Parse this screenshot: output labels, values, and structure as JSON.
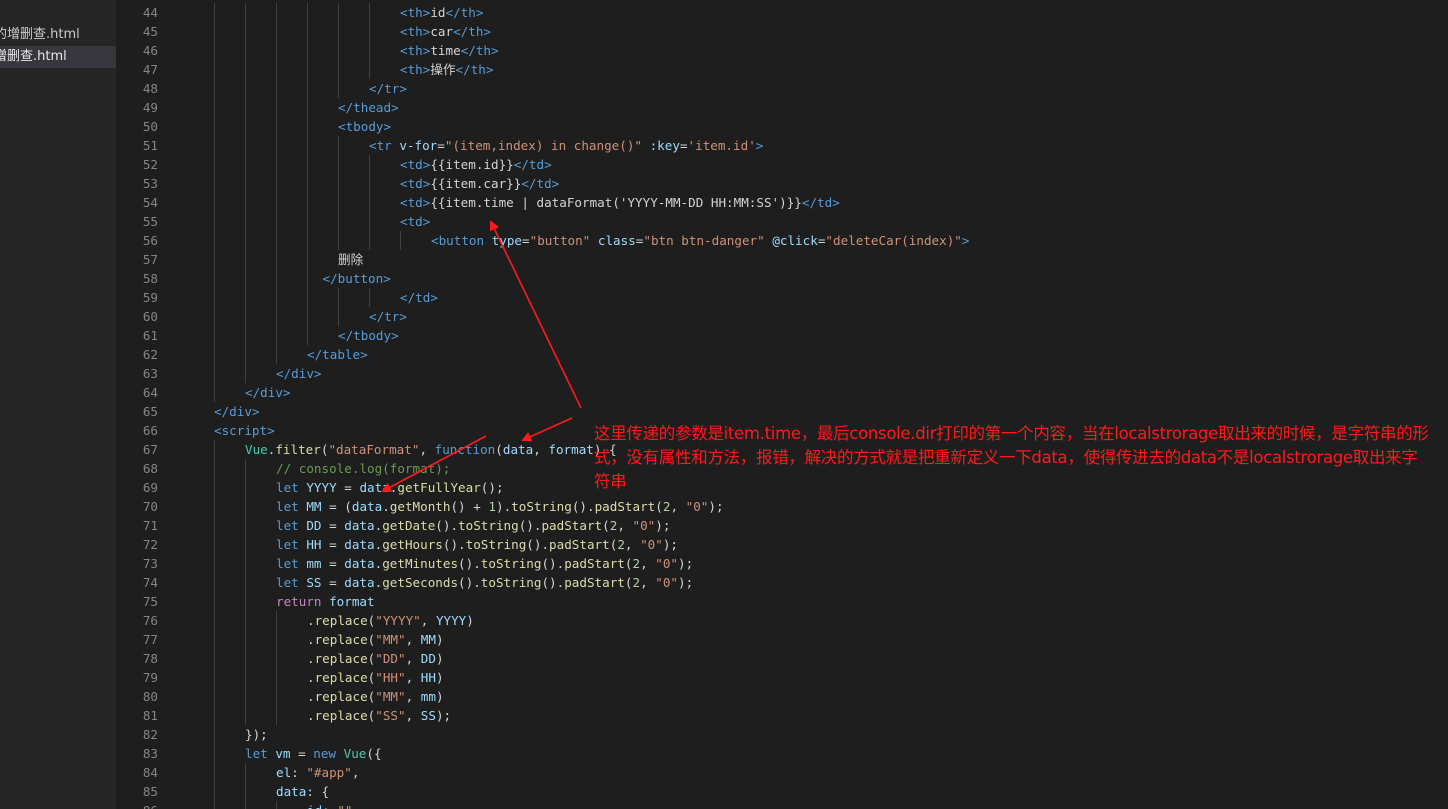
{
  "explorer": {
    "files": [
      {
        "label": "的增删查.html",
        "active": false
      },
      {
        "label": "增删查.html",
        "active": true
      }
    ]
  },
  "editor": {
    "lines": [
      {
        "n": "44",
        "indent": 6,
        "tokens": [
          [
            "tag",
            "<th>"
          ],
          [
            "text",
            "id"
          ],
          [
            "tag",
            "</th>"
          ]
        ]
      },
      {
        "n": "45",
        "indent": 6,
        "tokens": [
          [
            "tag",
            "<th>"
          ],
          [
            "text",
            "car"
          ],
          [
            "tag",
            "</th>"
          ]
        ]
      },
      {
        "n": "46",
        "indent": 6,
        "tokens": [
          [
            "tag",
            "<th>"
          ],
          [
            "text",
            "time"
          ],
          [
            "tag",
            "</th>"
          ]
        ]
      },
      {
        "n": "47",
        "indent": 6,
        "tokens": [
          [
            "tag",
            "<th>"
          ],
          [
            "text",
            "操作"
          ],
          [
            "tag",
            "</th>"
          ]
        ]
      },
      {
        "n": "48",
        "indent": 5,
        "tokens": [
          [
            "tag",
            "</tr>"
          ]
        ]
      },
      {
        "n": "49",
        "indent": 4,
        "tokens": [
          [
            "tag",
            "</thead>"
          ]
        ]
      },
      {
        "n": "50",
        "indent": 4,
        "tokens": [
          [
            "tag",
            "<tbody>"
          ]
        ]
      },
      {
        "n": "51",
        "indent": 5,
        "tokens": [
          [
            "tag",
            "<tr "
          ],
          [
            "attr",
            "v-for"
          ],
          [
            "punc",
            "="
          ],
          [
            "str",
            "\"(item,index) in change()\""
          ],
          [
            "punc",
            " "
          ],
          [
            "attr",
            ":key"
          ],
          [
            "punc",
            "="
          ],
          [
            "str",
            "'item.id'"
          ],
          [
            "tag",
            ">"
          ]
        ]
      },
      {
        "n": "52",
        "indent": 6,
        "tokens": [
          [
            "tag",
            "<td>"
          ],
          [
            "text",
            "{{item.id}}"
          ],
          [
            "tag",
            "</td>"
          ]
        ]
      },
      {
        "n": "53",
        "indent": 6,
        "tokens": [
          [
            "tag",
            "<td>"
          ],
          [
            "text",
            "{{item.car}}"
          ],
          [
            "tag",
            "</td>"
          ]
        ]
      },
      {
        "n": "54",
        "indent": 6,
        "tokens": [
          [
            "tag",
            "<td>"
          ],
          [
            "text",
            "{{item.time | dataFormat('YYYY-MM-DD HH:MM:SS')}}"
          ],
          [
            "tag",
            "</td>"
          ]
        ]
      },
      {
        "n": "55",
        "indent": 6,
        "tokens": [
          [
            "tag",
            "<td>"
          ]
        ]
      },
      {
        "n": "56",
        "indent": 7,
        "tokens": [
          [
            "tag",
            "<button "
          ],
          [
            "attr",
            "type"
          ],
          [
            "punc",
            "="
          ],
          [
            "str",
            "\"button\""
          ],
          [
            "punc",
            " "
          ],
          [
            "attr",
            "class"
          ],
          [
            "punc",
            "="
          ],
          [
            "str",
            "\"btn btn-danger\""
          ],
          [
            "punc",
            " "
          ],
          [
            "attr",
            "@click"
          ],
          [
            "punc",
            "="
          ],
          [
            "str",
            "\"deleteCar(index)\""
          ],
          [
            "tag",
            ">"
          ]
        ]
      },
      {
        "n": "57",
        "indent": 4,
        "tokens": [
          [
            "text",
            "删除"
          ]
        ]
      },
      {
        "n": "58",
        "indent": 3.5,
        "tokens": [
          [
            "tag",
            "</button>"
          ]
        ]
      },
      {
        "n": "59",
        "indent": 6,
        "tokens": [
          [
            "tag",
            "</td>"
          ]
        ]
      },
      {
        "n": "60",
        "indent": 5,
        "tokens": [
          [
            "tag",
            "</tr>"
          ]
        ]
      },
      {
        "n": "61",
        "indent": 4,
        "tokens": [
          [
            "tag",
            "</tbody>"
          ]
        ]
      },
      {
        "n": "62",
        "indent": 3,
        "tokens": [
          [
            "tag",
            "</table>"
          ]
        ]
      },
      {
        "n": "63",
        "indent": 2,
        "tokens": [
          [
            "tag",
            "</div>"
          ]
        ]
      },
      {
        "n": "64",
        "indent": 1,
        "tokens": [
          [
            "tag",
            "</div>"
          ]
        ]
      },
      {
        "n": "65",
        "indent": 0,
        "tokens": [
          [
            "tag",
            "</div>"
          ]
        ]
      },
      {
        "n": "66",
        "indent": 0,
        "tokens": [
          [
            "tag",
            "<script>"
          ]
        ]
      },
      {
        "n": "67",
        "indent": 1,
        "tokens": [
          [
            "obj",
            "Vue"
          ],
          [
            "punc",
            "."
          ],
          [
            "fn",
            "filter"
          ],
          [
            "punc",
            "("
          ],
          [
            "str",
            "\"dataFormat\""
          ],
          [
            "punc",
            ", "
          ],
          [
            "kw",
            "function"
          ],
          [
            "punc",
            "("
          ],
          [
            "var",
            "data"
          ],
          [
            "punc",
            ", "
          ],
          [
            "var",
            "format"
          ],
          [
            "punc",
            ") {"
          ]
        ]
      },
      {
        "n": "68",
        "indent": 2,
        "tokens": [
          [
            "com",
            "// console.log(format);"
          ]
        ]
      },
      {
        "n": "69",
        "indent": 2,
        "tokens": [
          [
            "kw",
            "let "
          ],
          [
            "var",
            "YYYY"
          ],
          [
            "punc",
            " = "
          ],
          [
            "var",
            "data"
          ],
          [
            "punc",
            "."
          ],
          [
            "fn",
            "getFullYear"
          ],
          [
            "punc",
            "();"
          ]
        ]
      },
      {
        "n": "70",
        "indent": 2,
        "tokens": [
          [
            "kw",
            "let "
          ],
          [
            "var",
            "MM"
          ],
          [
            "punc",
            " = ("
          ],
          [
            "var",
            "data"
          ],
          [
            "punc",
            "."
          ],
          [
            "fn",
            "getMonth"
          ],
          [
            "punc",
            "() + "
          ],
          [
            "num",
            "1"
          ],
          [
            "punc",
            ")."
          ],
          [
            "fn",
            "toString"
          ],
          [
            "punc",
            "()."
          ],
          [
            "fn",
            "padStart"
          ],
          [
            "punc",
            "("
          ],
          [
            "num",
            "2"
          ],
          [
            "punc",
            ", "
          ],
          [
            "str",
            "\"0\""
          ],
          [
            "punc",
            ");"
          ]
        ]
      },
      {
        "n": "71",
        "indent": 2,
        "tokens": [
          [
            "kw",
            "let "
          ],
          [
            "var",
            "DD"
          ],
          [
            "punc",
            " = "
          ],
          [
            "var",
            "data"
          ],
          [
            "punc",
            "."
          ],
          [
            "fn",
            "getDate"
          ],
          [
            "punc",
            "()."
          ],
          [
            "fn",
            "toString"
          ],
          [
            "punc",
            "()."
          ],
          [
            "fn",
            "padStart"
          ],
          [
            "punc",
            "("
          ],
          [
            "num",
            "2"
          ],
          [
            "punc",
            ", "
          ],
          [
            "str",
            "\"0\""
          ],
          [
            "punc",
            ");"
          ]
        ]
      },
      {
        "n": "72",
        "indent": 2,
        "tokens": [
          [
            "kw",
            "let "
          ],
          [
            "var",
            "HH"
          ],
          [
            "punc",
            " = "
          ],
          [
            "var",
            "data"
          ],
          [
            "punc",
            "."
          ],
          [
            "fn",
            "getHours"
          ],
          [
            "punc",
            "()."
          ],
          [
            "fn",
            "toString"
          ],
          [
            "punc",
            "()."
          ],
          [
            "fn",
            "padStart"
          ],
          [
            "punc",
            "("
          ],
          [
            "num",
            "2"
          ],
          [
            "punc",
            ", "
          ],
          [
            "str",
            "\"0\""
          ],
          [
            "punc",
            ");"
          ]
        ]
      },
      {
        "n": "73",
        "indent": 2,
        "tokens": [
          [
            "kw",
            "let "
          ],
          [
            "var",
            "mm"
          ],
          [
            "punc",
            " = "
          ],
          [
            "var",
            "data"
          ],
          [
            "punc",
            "."
          ],
          [
            "fn",
            "getMinutes"
          ],
          [
            "punc",
            "()."
          ],
          [
            "fn",
            "toString"
          ],
          [
            "punc",
            "()."
          ],
          [
            "fn",
            "padStart"
          ],
          [
            "punc",
            "("
          ],
          [
            "num",
            "2"
          ],
          [
            "punc",
            ", "
          ],
          [
            "str",
            "\"0\""
          ],
          [
            "punc",
            ");"
          ]
        ]
      },
      {
        "n": "74",
        "indent": 2,
        "tokens": [
          [
            "kw",
            "let "
          ],
          [
            "var",
            "SS"
          ],
          [
            "punc",
            " = "
          ],
          [
            "var",
            "data"
          ],
          [
            "punc",
            "."
          ],
          [
            "fn",
            "getSeconds"
          ],
          [
            "punc",
            "()."
          ],
          [
            "fn",
            "toString"
          ],
          [
            "punc",
            "()."
          ],
          [
            "fn",
            "padStart"
          ],
          [
            "punc",
            "("
          ],
          [
            "num",
            "2"
          ],
          [
            "punc",
            ", "
          ],
          [
            "str",
            "\"0\""
          ],
          [
            "punc",
            ");"
          ]
        ]
      },
      {
        "n": "75",
        "indent": 2,
        "tokens": [
          [
            "ctrl",
            "return "
          ],
          [
            "var",
            "format"
          ]
        ]
      },
      {
        "n": "76",
        "indent": 3,
        "tokens": [
          [
            "punc",
            "."
          ],
          [
            "fn",
            "replace"
          ],
          [
            "punc",
            "("
          ],
          [
            "str",
            "\"YYYY\""
          ],
          [
            "punc",
            ", "
          ],
          [
            "var",
            "YYYY"
          ],
          [
            "punc",
            ")"
          ]
        ]
      },
      {
        "n": "77",
        "indent": 3,
        "tokens": [
          [
            "punc",
            "."
          ],
          [
            "fn",
            "replace"
          ],
          [
            "punc",
            "("
          ],
          [
            "str",
            "\"MM\""
          ],
          [
            "punc",
            ", "
          ],
          [
            "var",
            "MM"
          ],
          [
            "punc",
            ")"
          ]
        ]
      },
      {
        "n": "78",
        "indent": 3,
        "tokens": [
          [
            "punc",
            "."
          ],
          [
            "fn",
            "replace"
          ],
          [
            "punc",
            "("
          ],
          [
            "str",
            "\"DD\""
          ],
          [
            "punc",
            ", "
          ],
          [
            "var",
            "DD"
          ],
          [
            "punc",
            ")"
          ]
        ]
      },
      {
        "n": "79",
        "indent": 3,
        "tokens": [
          [
            "punc",
            "."
          ],
          [
            "fn",
            "replace"
          ],
          [
            "punc",
            "("
          ],
          [
            "str",
            "\"HH\""
          ],
          [
            "punc",
            ", "
          ],
          [
            "var",
            "HH"
          ],
          [
            "punc",
            ")"
          ]
        ]
      },
      {
        "n": "80",
        "indent": 3,
        "tokens": [
          [
            "punc",
            "."
          ],
          [
            "fn",
            "replace"
          ],
          [
            "punc",
            "("
          ],
          [
            "str",
            "\"MM\""
          ],
          [
            "punc",
            ", "
          ],
          [
            "var",
            "mm"
          ],
          [
            "punc",
            ")"
          ]
        ]
      },
      {
        "n": "81",
        "indent": 3,
        "tokens": [
          [
            "punc",
            "."
          ],
          [
            "fn",
            "replace"
          ],
          [
            "punc",
            "("
          ],
          [
            "str",
            "\"SS\""
          ],
          [
            "punc",
            ", "
          ],
          [
            "var",
            "SS"
          ],
          [
            "punc",
            ");"
          ]
        ]
      },
      {
        "n": "82",
        "indent": 1,
        "tokens": [
          [
            "punc",
            "});"
          ]
        ]
      },
      {
        "n": "83",
        "indent": 1,
        "tokens": [
          [
            "kw",
            "let "
          ],
          [
            "var",
            "vm"
          ],
          [
            "punc",
            " = "
          ],
          [
            "kw",
            "new "
          ],
          [
            "obj",
            "Vue"
          ],
          [
            "punc",
            "({"
          ]
        ]
      },
      {
        "n": "84",
        "indent": 2,
        "tokens": [
          [
            "var",
            "el"
          ],
          [
            "punc",
            ": "
          ],
          [
            "str",
            "\"#app\""
          ],
          [
            "punc",
            ","
          ]
        ]
      },
      {
        "n": "85",
        "indent": 2,
        "tokens": [
          [
            "var",
            "data"
          ],
          [
            "punc",
            ": {"
          ]
        ]
      },
      {
        "n": "86",
        "indent": 3,
        "tokens": [
          [
            "var",
            "id"
          ],
          [
            "punc",
            ": "
          ],
          [
            "str",
            "\"\""
          ],
          [
            "punc",
            ","
          ]
        ]
      }
    ]
  },
  "annotation": {
    "text": "这里传递的参数是item.time，最后console.dir打印的第一个内容，当在localstrorage取出来的时候，是字符串的形式，没有属性和方法，报错，解决的方式就是把重新定义一下data，使得传进去的data不是localstrorage取出来字符串",
    "color": "#ff1a1a"
  }
}
